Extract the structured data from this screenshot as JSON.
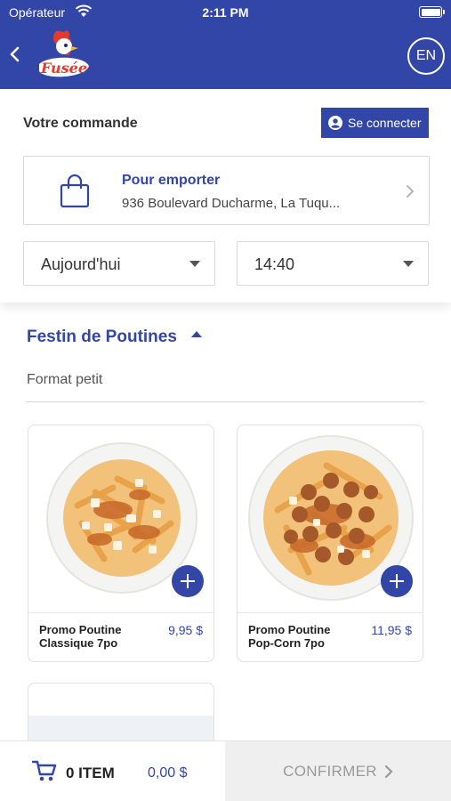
{
  "status_bar": {
    "carrier": "Opérateur",
    "time": "2:11 PM"
  },
  "header": {
    "language_button": "EN",
    "logo_text": "Fusée"
  },
  "order": {
    "title": "Votre commande",
    "connect_button": "Se connecter",
    "pickup": {
      "mode": "Pour emporter",
      "address": "936 Boulevard Ducharme, La Tuqu..."
    },
    "day_select": "Aujourd'hui",
    "time_select": "14:40"
  },
  "menu": {
    "section_title": "Festin de Poutines",
    "subsection": "Format petit",
    "products": [
      {
        "name": "Promo Poutine Classique 7po",
        "price": "9,95 $"
      },
      {
        "name": "Promo Poutine Pop-Corn 7po",
        "price": "11,95 $"
      }
    ]
  },
  "cart": {
    "items": "0 ITEM",
    "total": "0,00 $",
    "confirm": "CONFIRMER"
  },
  "colors": {
    "brand": "#3246a8",
    "gravy": "#c8682a",
    "fries": "#f2c27a"
  }
}
